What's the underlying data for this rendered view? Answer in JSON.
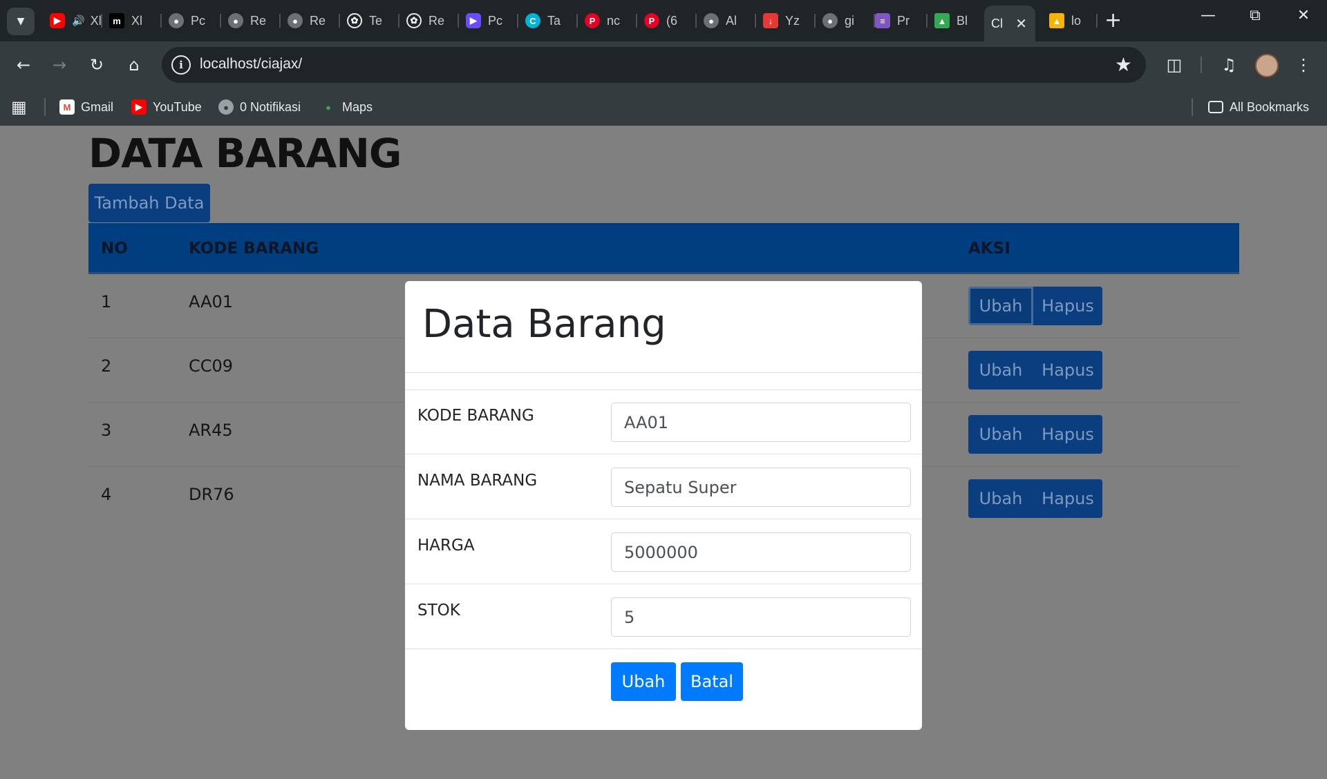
{
  "browser": {
    "tabs": [
      {
        "label": "Xl",
        "icon": "youtube-icon",
        "color": "#ff0000"
      },
      {
        "label": "Xl",
        "icon": "m-logo-icon",
        "color": "#000000"
      },
      {
        "label": "Pc",
        "icon": "globe-icon",
        "color": "#9aa0a6"
      },
      {
        "label": "Re",
        "icon": "globe-icon",
        "color": "#9aa0a6"
      },
      {
        "label": "Re",
        "icon": "globe-icon",
        "color": "#9aa0a6"
      },
      {
        "label": "Te",
        "icon": "openai-icon",
        "color": "#e8eaed"
      },
      {
        "label": "Re",
        "icon": "openai-icon",
        "color": "#e8eaed"
      },
      {
        "label": "Pc",
        "icon": "video-icon",
        "color": "#6a4cff"
      },
      {
        "label": "Ta",
        "icon": "canva-icon",
        "color": "#00b4d8"
      },
      {
        "label": "nc",
        "icon": "pinterest-icon",
        "color": "#e60023"
      },
      {
        "label": "(6",
        "icon": "pinterest-icon",
        "color": "#e60023"
      },
      {
        "label": "Al",
        "icon": "globe-icon",
        "color": "#9aa0a6"
      },
      {
        "label": "Yz",
        "icon": "download-icon",
        "color": "#e53935"
      },
      {
        "label": "gi",
        "icon": "globe-icon",
        "color": "#9aa0a6"
      },
      {
        "label": "Pr",
        "icon": "list-icon",
        "color": "#7e57c2"
      },
      {
        "label": "Bl",
        "icon": "drive-icon",
        "color": "#34a853"
      },
      {
        "label": "Cl",
        "icon": "",
        "color": "#e8eaed"
      },
      {
        "label": "lo",
        "icon": "sitemap-icon",
        "color": "#f4b400"
      }
    ],
    "url": "localhost/ciajax/",
    "bookmarks": {
      "gmail": "Gmail",
      "youtube": "YouTube",
      "notifikasi": "0 Notifikasi",
      "maps": "Maps",
      "all": "All Bookmarks"
    }
  },
  "page": {
    "title": "DATA BARANG",
    "add_button": "Tambah Data",
    "columns": {
      "no": "NO",
      "kode": "KODE BARANG",
      "aksi": "AKSI"
    },
    "rows": [
      {
        "no": "1",
        "kode": "AA01",
        "edit": "Ubah",
        "delete": "Hapus"
      },
      {
        "no": "2",
        "kode": "CC09",
        "edit": "Ubah",
        "delete": "Hapus"
      },
      {
        "no": "3",
        "kode": "AR45",
        "edit": "Ubah",
        "delete": "Hapus"
      },
      {
        "no": "4",
        "kode": "DR76",
        "edit": "Ubah",
        "delete": "Hapus"
      }
    ]
  },
  "modal": {
    "title": "Data Barang",
    "fields": {
      "kode": {
        "label": "KODE BARANG",
        "value": "AA01"
      },
      "nama": {
        "label": "NAMA BARANG",
        "value": "Sepatu Super"
      },
      "harga": {
        "label": "HARGA",
        "value": "5000000"
      },
      "stok": {
        "label": "STOK",
        "value": "5"
      }
    },
    "submit": "Ubah",
    "cancel": "Batal"
  },
  "colors": {
    "primary": "#007bff",
    "dimmed_primary": "#0a3e7f",
    "backdrop": "#808080"
  }
}
